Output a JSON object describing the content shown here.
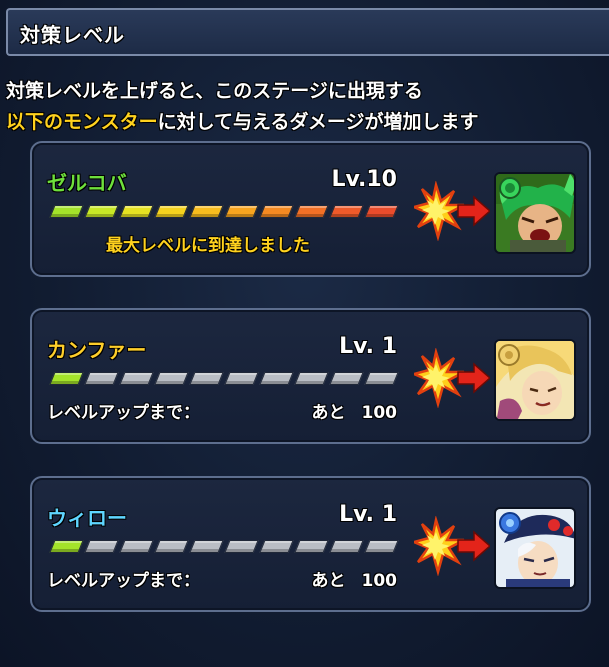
{
  "header": {
    "title": "対策レベル"
  },
  "description": {
    "line1": "対策レベルを上げると、このステージに出現する",
    "line2_highlight": "以下のモンスター",
    "line2_rest": "に対して与えるダメージが増加します"
  },
  "monsters": [
    {
      "name": "ゼルコバ",
      "name_color": "#6ee03c",
      "level": "Lv.10",
      "level_value": 10,
      "max_level": 10,
      "status": "最大レベルに到達しました",
      "portrait_icon": "green-horned-monster-portrait"
    },
    {
      "name": "カンファー",
      "name_color": "#ffcf2a",
      "level": "Lv. 1",
      "level_value": 1,
      "max_level": 10,
      "levelup_label": "レベルアップまで：",
      "remaining_label": "あと",
      "remaining_value": "100",
      "portrait_icon": "golden-haired-monster-portrait"
    },
    {
      "name": "ウィロー",
      "name_color": "#5fd6ff",
      "level": "Lv. 1",
      "level_value": 1,
      "max_level": 10,
      "levelup_label": "レベルアップまで：",
      "remaining_label": "あと",
      "remaining_value": "100",
      "portrait_icon": "blue-hat-monster-portrait"
    }
  ],
  "colors": {
    "highlight": "#ffd21e",
    "bar_gradient": [
      "#a4e32a",
      "#c8e826",
      "#e6e222",
      "#f5d21e",
      "#f7bc1e",
      "#f7a41f",
      "#f58a22",
      "#f27026",
      "#ee5a2a",
      "#e94c2c"
    ],
    "bar_empty": "#b9bdc4",
    "bar_start_single": "#a4e32a"
  }
}
